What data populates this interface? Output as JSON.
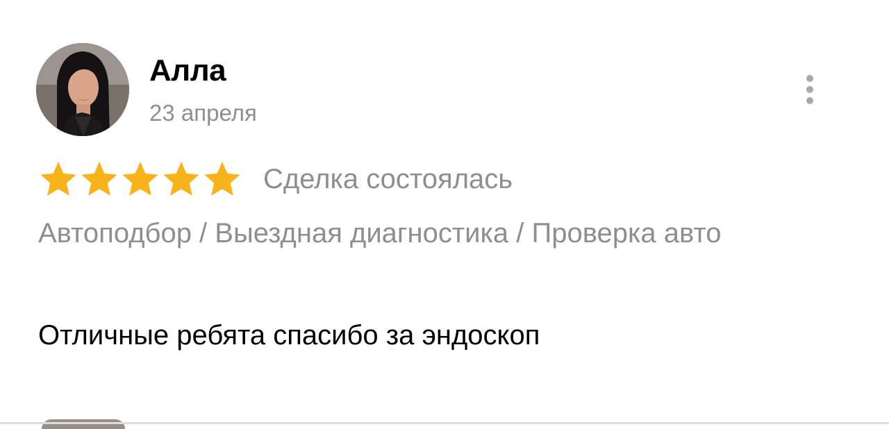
{
  "review": {
    "author": "Алла",
    "date": "23 апреля",
    "rating": 5,
    "rating_max": 5,
    "deal_status": "Сделка состоялась",
    "category": "Автоподбор / Выездная диагностика / Проверка авто",
    "text": "Отличные ребята спасибо за эндоскоп"
  },
  "icons": {
    "more": "more-vertical-icon",
    "star": "star-icon"
  },
  "colors": {
    "star": "#F9B31A",
    "secondary_text": "#8E8E8E",
    "more_dots": "#A8A8A8"
  }
}
